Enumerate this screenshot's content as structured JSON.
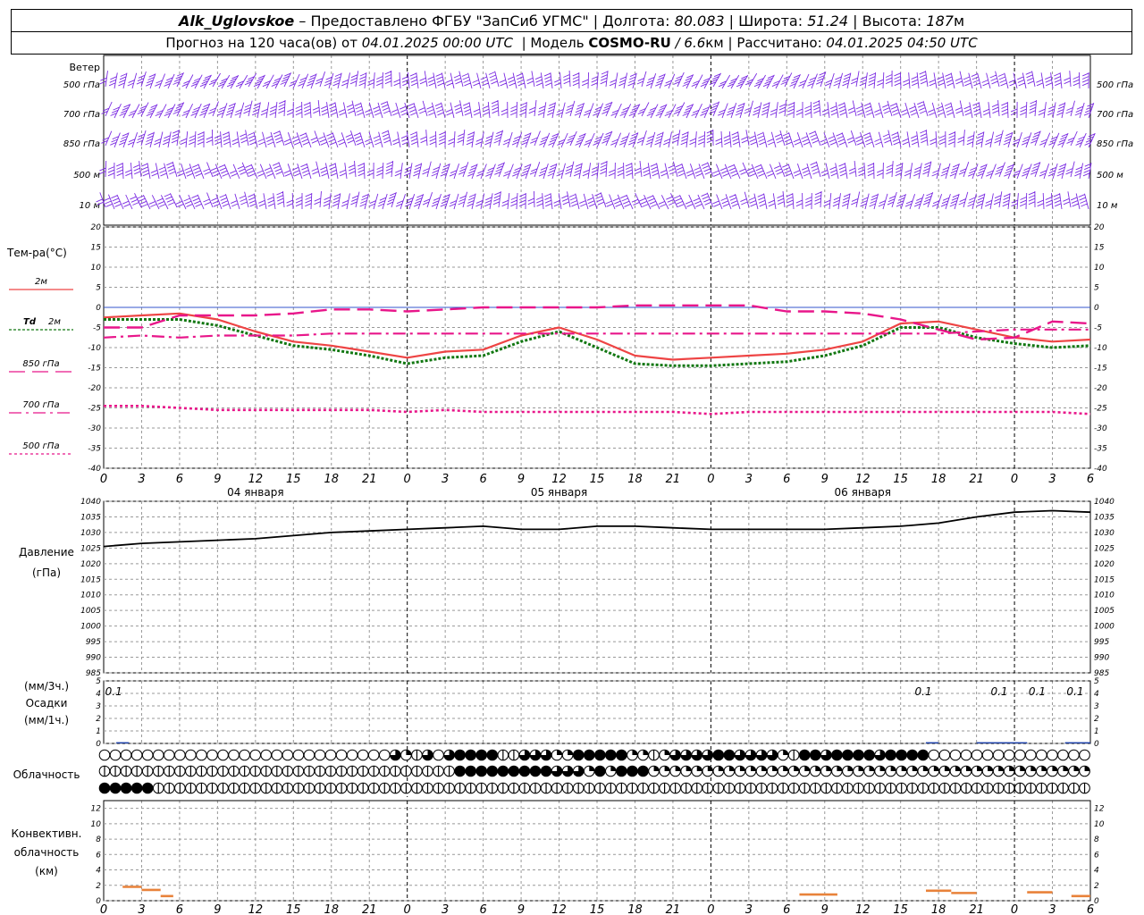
{
  "header": {
    "station": "Alk_Uglovskoe",
    "dash": "–",
    "provider": "Предоставлено ФГБУ \"ЗапСиб УГМС\"",
    "sep": "|",
    "lon_label": "Долгота:",
    "lon_value": "80.083",
    "lat_label": "Широта:",
    "lat_value": "51.24",
    "alt_label": "Высота:",
    "alt_value": "187",
    "alt_unit": "м",
    "forecast_prefix": "Прогноз на 120 часа(ов) от",
    "forecast_start": "04.01.2025 00:00 UTC",
    "model_label": "Модель",
    "model_name": "COSMO-RU",
    "model_res": "/ 6.6",
    "model_res_unit": "км",
    "calc_label": "Рассчитано:",
    "calc_time": "04.01.2025 04:50 UTC"
  },
  "colors": {
    "wind": "#7b2be2",
    "t2m": "#ee4444",
    "td2m": "#117711",
    "t850": "#e8168a",
    "t700": "#e8168a",
    "t500": "#e8168a",
    "pressure": "#000000",
    "precip": "#1a3ea8",
    "convective": "#e8823a",
    "grid": "#999999",
    "zero_line": "#3355cc"
  },
  "panels": {
    "wind": {
      "title": "Ветер",
      "levels": [
        "500 гПа",
        "700 гПа",
        "850 гПа",
        "500 м",
        "10 м"
      ]
    },
    "temperature": {
      "title": "Тем-ра(°C)",
      "legend": {
        "t2m": "2м",
        "td_label": "Td",
        "td_level": "2м",
        "t850": "850 гПа",
        "t700": "700 гПа",
        "t500": "500 гПа"
      }
    },
    "pressure": {
      "title": "Давление",
      "unit": "(гПа)"
    },
    "precip": {
      "title_unit1": "(мм/3ч.)",
      "title": "Осадки",
      "title_unit2": "(мм/1ч.)"
    },
    "clouds": {
      "title": "Облачность"
    },
    "convective": {
      "title1": "Конвективн.",
      "title2": "облачность",
      "unit": "(км)"
    }
  },
  "time_axis": {
    "hour_ticks": [
      "0",
      "3",
      "6",
      "9",
      "12",
      "15",
      "18",
      "21",
      "0",
      "3",
      "6",
      "9",
      "12",
      "15",
      "18",
      "21",
      "0",
      "3",
      "6",
      "9",
      "12",
      "15",
      "18",
      "21",
      "0",
      "3",
      "6"
    ],
    "dates": [
      "04 января",
      "05 января",
      "06 января"
    ]
  },
  "chart_data": [
    {
      "type": "line",
      "name": "temperature",
      "ylim": [
        -40,
        20
      ],
      "yticks": [
        "20",
        "15",
        "10",
        "5",
        "0",
        "-5",
        "-10",
        "-15",
        "-20",
        "-25",
        "-30",
        "-35",
        "-40"
      ],
      "x": [
        0,
        3,
        6,
        9,
        12,
        15,
        18,
        21,
        24,
        27,
        30,
        33,
        36,
        39,
        42,
        45,
        48,
        51,
        54,
        57,
        60,
        63,
        66,
        69,
        72,
        75,
        78
      ],
      "series": [
        {
          "name": "2м",
          "values": [
            -2.5,
            -2,
            -1.5,
            -3,
            -6,
            -8.5,
            -9.5,
            -11,
            -12.5,
            -11,
            -10.5,
            -7,
            -5,
            -8,
            -12,
            -13,
            -12.5,
            -12,
            -11.5,
            -10.5,
            -8.5,
            -4,
            -3.5,
            -5.5,
            -7.5,
            -8.5,
            -8
          ]
        },
        {
          "name": "Td 2м",
          "values": [
            -3,
            -3,
            -3,
            -4.5,
            -7,
            -9.5,
            -10.5,
            -12,
            -14,
            -12.5,
            -12,
            -8.5,
            -6,
            -10,
            -14,
            -14.5,
            -14.5,
            -14,
            -13.5,
            -12,
            -9.5,
            -5,
            -5,
            -7.5,
            -9,
            -10,
            -9.5
          ]
        },
        {
          "name": "850 гПа",
          "values": [
            -5,
            -5,
            -2,
            -2,
            -2,
            -1.5,
            -0.5,
            -0.5,
            -1,
            -0.5,
            0,
            0,
            0,
            0,
            0.5,
            0.5,
            0.5,
            0.5,
            -1,
            -1,
            -1.5,
            -3,
            -5.5,
            -8,
            -7.5,
            -3.5,
            -4
          ]
        },
        {
          "name": "700 гПа",
          "values": [
            -7.5,
            -7,
            -7.5,
            -7,
            -7,
            -7,
            -6.5,
            -6.5,
            -6.5,
            -6.5,
            -6.5,
            -6.5,
            -6.5,
            -6.5,
            -6.5,
            -6.5,
            -6.5,
            -6.5,
            -6.5,
            -6.5,
            -6.5,
            -6.5,
            -6.5,
            -6,
            -5.5,
            -5.5,
            -5.5
          ]
        },
        {
          "name": "500 гПа",
          "values": [
            -24.5,
            -24.5,
            -25,
            -25.5,
            -25.5,
            -25.5,
            -25.5,
            -25.5,
            -26,
            -25.5,
            -26,
            -26,
            -26,
            -26,
            -26,
            -26,
            -26.5,
            -26,
            -26,
            -26,
            -26,
            -26,
            -26,
            -26,
            -26,
            -26,
            -26.5
          ]
        }
      ]
    },
    {
      "type": "line",
      "name": "pressure",
      "ylim": [
        985,
        1040
      ],
      "yticks": [
        "1040",
        "1035",
        "1030",
        "1025",
        "1020",
        "1015",
        "1010",
        "1005",
        "1000",
        "995",
        "990",
        "985"
      ],
      "x": [
        0,
        3,
        6,
        9,
        12,
        15,
        18,
        21,
        24,
        27,
        30,
        33,
        36,
        39,
        42,
        45,
        48,
        51,
        54,
        57,
        60,
        63,
        66,
        69,
        72,
        75,
        78
      ],
      "series": [
        {
          "name": "Давление",
          "values": [
            1025.5,
            1026.5,
            1027,
            1027.5,
            1028,
            1029,
            1030,
            1030.5,
            1031,
            1031.5,
            1032,
            1031,
            1031,
            1032,
            1032,
            1031.5,
            1031,
            1031,
            1031,
            1031,
            1031.5,
            1032,
            1033,
            1035,
            1036.5,
            1037,
            1036.5
          ]
        }
      ]
    },
    {
      "type": "bar",
      "name": "precipitation",
      "ylim": [
        0,
        5
      ],
      "yticks": [
        "5",
        "4",
        "3",
        "2",
        "1",
        "0"
      ],
      "labels": [
        {
          "x": 1.5,
          "text": "0.1"
        },
        {
          "x": 65.5,
          "text": "0.1"
        },
        {
          "x": 71.5,
          "text": "0.1"
        },
        {
          "x": 74.5,
          "text": "0.1"
        },
        {
          "x": 77.5,
          "text": "0.1"
        }
      ],
      "bars": [
        {
          "x0": 1,
          "x1": 2,
          "value": 0.1
        },
        {
          "x0": 65,
          "x1": 66,
          "value": 0.1
        },
        {
          "x0": 69,
          "x1": 73,
          "value": 0.1
        },
        {
          "x0": 76,
          "x1": 78,
          "value": 0.1
        }
      ]
    },
    {
      "type": "bar",
      "name": "convective",
      "ylim": [
        0,
        13
      ],
      "yticks": [
        "12",
        "10",
        "8",
        "6",
        "4",
        "2",
        "0"
      ],
      "segments": [
        {
          "x0": 1.5,
          "x1": 3,
          "value": 1.8
        },
        {
          "x0": 3,
          "x1": 4.5,
          "value": 1.4
        },
        {
          "x0": 4.5,
          "x1": 5.5,
          "value": 0.6
        },
        {
          "x0": 55,
          "x1": 58,
          "value": 0.8
        },
        {
          "x0": 65,
          "x1": 67,
          "value": 1.3
        },
        {
          "x0": 67,
          "x1": 69,
          "value": 1.0
        },
        {
          "x0": 73,
          "x1": 75,
          "value": 1.1
        },
        {
          "x0": 76.5,
          "x1": 78,
          "value": 0.6
        }
      ]
    },
    {
      "type": "table",
      "name": "cloud_cover",
      "rows": {
        "upper": "00000000000000000000000000031238344442233311444441121333344333312443444434444000000000000000",
        "middle": "22222222222222222222222222222222244444444433314144411111111111111111111111111111111111111111",
        "lower": "44444222222222222222222222222222222222222222222222222222222222222222222222222222222222222222"
      }
    }
  ]
}
